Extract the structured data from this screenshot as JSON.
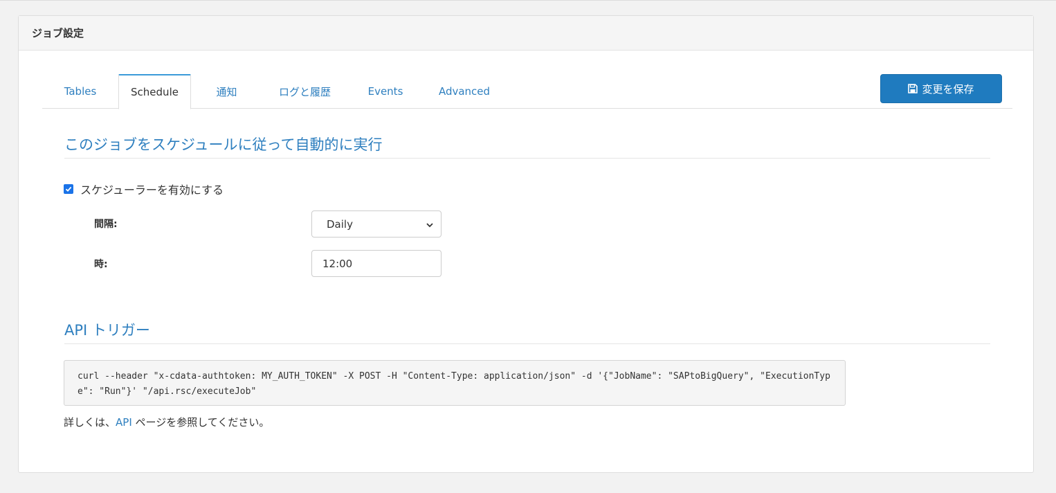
{
  "panel": {
    "title": "ジョブ設定"
  },
  "tabs": [
    {
      "label": "Tables"
    },
    {
      "label": "Schedule"
    },
    {
      "label": "通知"
    },
    {
      "label": "ログと履歴"
    },
    {
      "label": "Events"
    },
    {
      "label": "Advanced"
    }
  ],
  "active_tab": "Schedule",
  "toolbar": {
    "save_label": "変更を保存"
  },
  "schedule": {
    "heading": "このジョブをスケジュールに従って自動的に実行",
    "enable_label": "スケジューラーを有効にする",
    "enabled": true,
    "interval_label": "間隔:",
    "interval_value": "Daily",
    "time_label": "時:",
    "time_value": "12:00"
  },
  "api": {
    "heading": "API トリガー",
    "command": "curl --header \"x-cdata-authtoken: MY_AUTH_TOKEN\" -X POST -H \"Content-Type: application/json\" -d '{\"JobName\": \"SAPtoBigQuery\", \"ExecutionType\": \"Run\"}' \"/api.rsc/executeJob\"",
    "note_prefix": "詳しくは、",
    "note_link": "API",
    "note_suffix": " ページを参照してください。"
  },
  "colors": {
    "accent": "#2e7fbf",
    "button": "#1f7bbf",
    "active_tab_border": "#3a9ad9",
    "checkbox": "#1a73e8"
  }
}
